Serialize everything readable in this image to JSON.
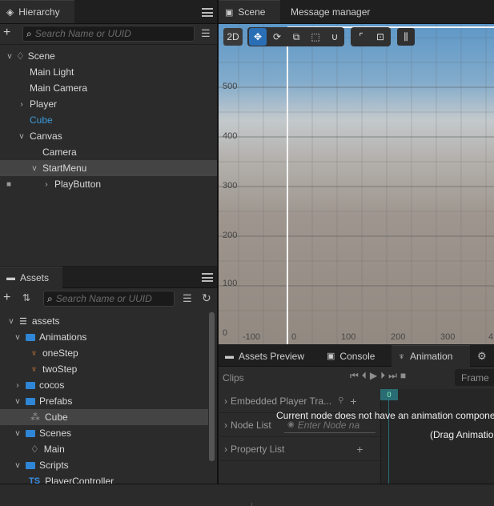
{
  "hierarchy": {
    "tab_label": "Hierarchy",
    "search_placeholder": "Search Name or UUID",
    "nodes": [
      {
        "label": "Scene"
      },
      {
        "label": "Main Light"
      },
      {
        "label": "Main Camera"
      },
      {
        "label": "Player"
      },
      {
        "label": "Cube"
      },
      {
        "label": "Canvas"
      },
      {
        "label": "Camera"
      },
      {
        "label": "StartMenu"
      },
      {
        "label": "PlayButton"
      }
    ]
  },
  "assets": {
    "tab_label": "Assets",
    "search_placeholder": "Search Name or UUID",
    "items": [
      {
        "label": "assets"
      },
      {
        "label": "Animations"
      },
      {
        "label": "oneStep"
      },
      {
        "label": "twoStep"
      },
      {
        "label": "cocos"
      },
      {
        "label": "Prefabs"
      },
      {
        "label": "Cube"
      },
      {
        "label": "Scenes"
      },
      {
        "label": "Main"
      },
      {
        "label": "Scripts"
      },
      {
        "label": "PlayerController"
      }
    ],
    "ts_badge": "TS"
  },
  "scene": {
    "tabs": [
      {
        "label": "Scene"
      },
      {
        "label": "Message manager"
      }
    ],
    "toolbar": {
      "mode_2d": "2D"
    },
    "y_ticks": [
      "500",
      "400",
      "300",
      "200",
      "100",
      "0"
    ],
    "x_ticks": [
      "-100",
      "0",
      "100",
      "200",
      "300",
      "4"
    ]
  },
  "bottom": {
    "tabs": [
      {
        "label": "Assets Preview"
      },
      {
        "label": "Console"
      },
      {
        "label": "Animation"
      }
    ],
    "clips_label": "Clips",
    "frame_label": "Frame",
    "embedded_label": "Embedded Player Tra...",
    "node_list_label": "Node List",
    "node_search_placeholder": "Enter Node na",
    "property_list_label": "Property List",
    "timeline_marker": "0",
    "message": "Current node does not have an animation compone",
    "hint": "(Drag Animatio"
  },
  "colors": {
    "accent": "#2f86d6",
    "selected_row": "#444444",
    "cube_text": "#3a9ad9"
  }
}
